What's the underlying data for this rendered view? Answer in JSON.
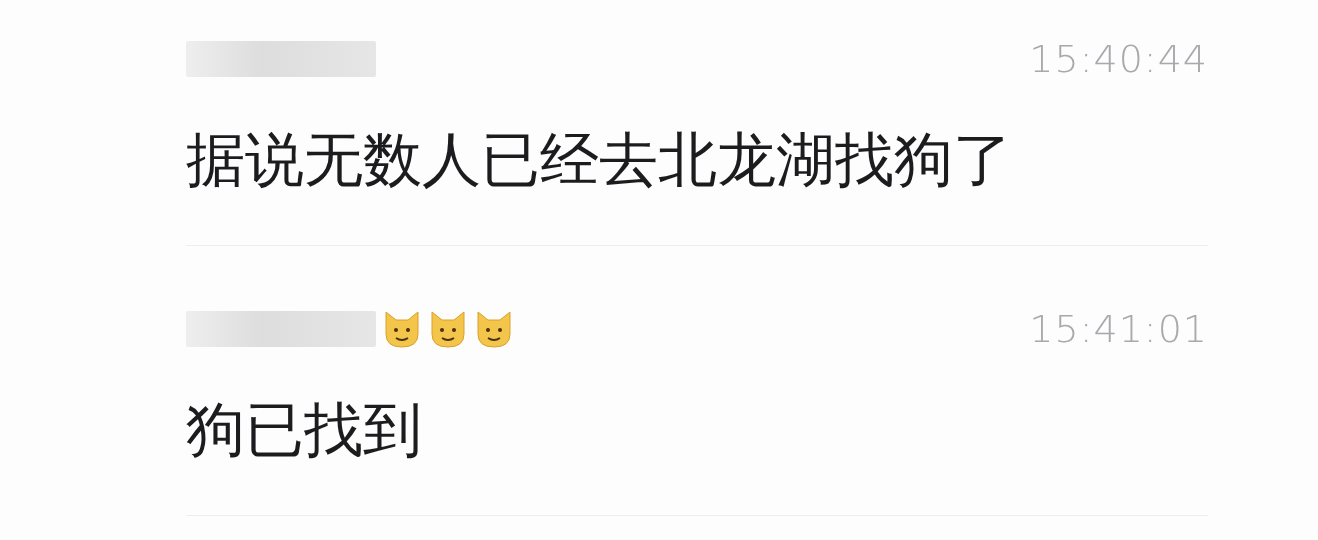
{
  "comments": [
    {
      "time": "15:40:44",
      "text": "据说无数人已经去北龙湖找狗了"
    },
    {
      "name_emojis": [
        {
          "kind": "cat"
        },
        {
          "kind": "cat"
        },
        {
          "kind": "cat"
        }
      ],
      "time": "15:41:01",
      "text": "狗已找到"
    }
  ]
}
